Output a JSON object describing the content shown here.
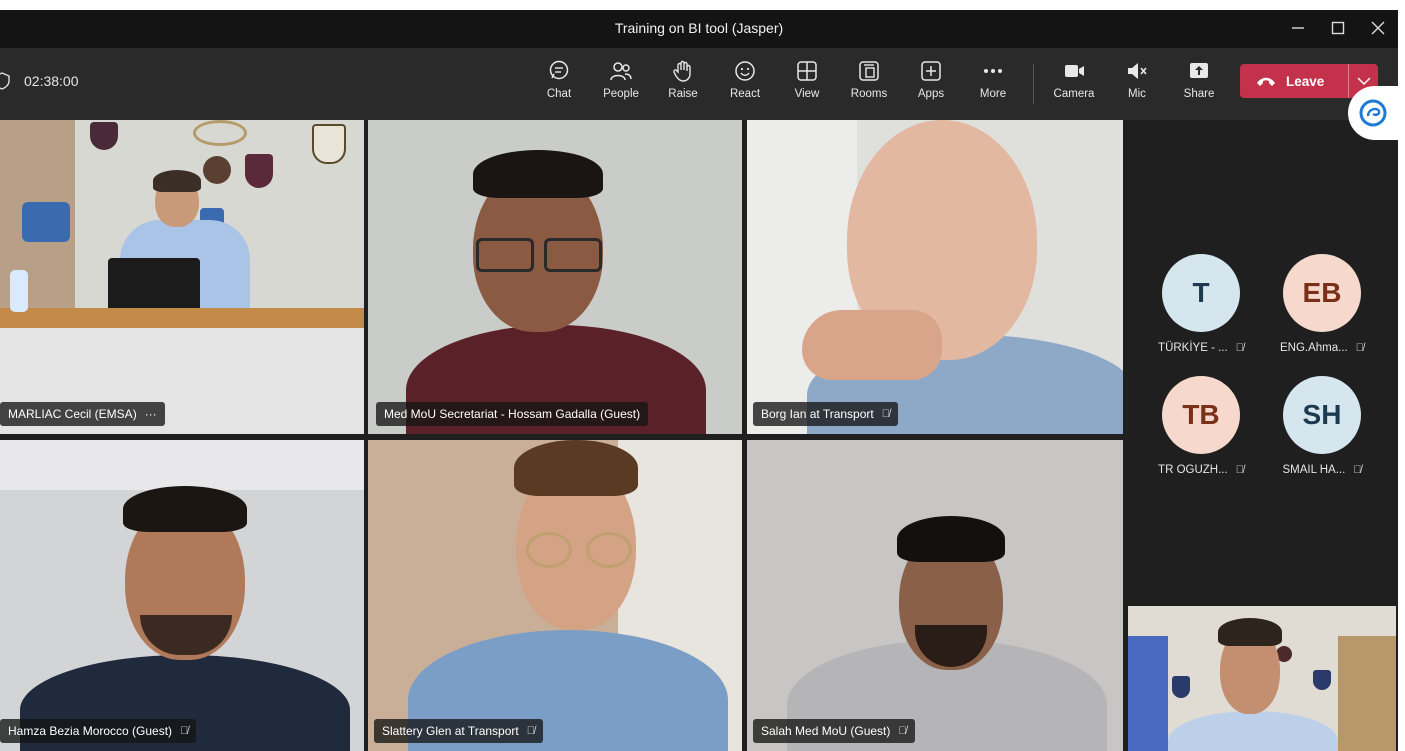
{
  "window": {
    "title": "Training on BI tool (Jasper)",
    "controls": [
      "minimize",
      "maximize",
      "close"
    ]
  },
  "meeting": {
    "timer": "02:38:00"
  },
  "toolbar": {
    "chat": "Chat",
    "people": "People",
    "raise": "Raise",
    "react": "React",
    "view": "View",
    "rooms": "Rooms",
    "apps": "Apps",
    "more": "More",
    "camera": "Camera",
    "mic": "Mic",
    "share": "Share",
    "leave": "Leave"
  },
  "participants": {
    "tile1": {
      "name": "MARLIAC Cecil (EMSA)",
      "extra": "···"
    },
    "tile2": {
      "name": "Med MoU Secretariat - Hossam Gadalla (Guest)"
    },
    "tile3": {
      "name": "Borg Ian at Transport",
      "muted": true
    },
    "tile4": {
      "name": "Hamza Bezia Morocco (Guest)",
      "muted": true
    },
    "tile5": {
      "name": "Slattery Glen at Transport",
      "muted": true
    },
    "tile6": {
      "name": "Salah Med MoU (Guest)",
      "muted": true
    }
  },
  "avatars": [
    {
      "initials": "T",
      "name": "TÜRKİYE - ...",
      "bg": "#d6e6ef",
      "fg": "#1d3a4f",
      "muted": true
    },
    {
      "initials": "EB",
      "name": "ENG.Ahma...",
      "bg": "#f6d9cc",
      "fg": "#7a2f18",
      "muted": true
    },
    {
      "initials": "TB",
      "name": "TR OGUZH...",
      "bg": "#f6d9cc",
      "fg": "#7a2f18",
      "muted": true
    },
    {
      "initials": "SH",
      "name": "SMAIL HA...",
      "bg": "#d6e6ef",
      "fg": "#1d3a4f",
      "muted": true
    }
  ],
  "colors": {
    "leave": "#c4314b",
    "toolbar": "#2a2a2a",
    "titlebar": "#141414",
    "stage": "#1f1f1f"
  }
}
